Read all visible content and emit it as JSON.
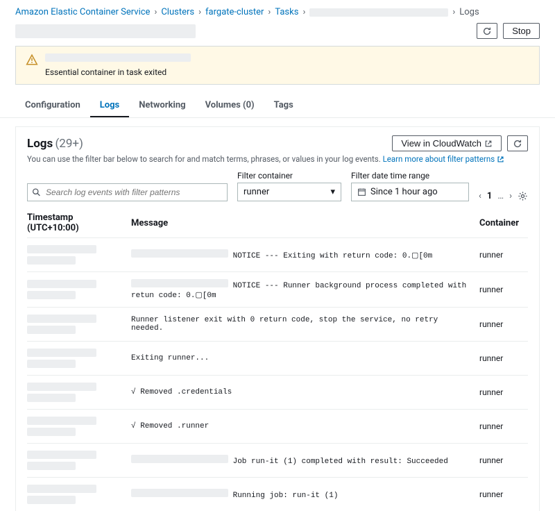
{
  "breadcrumb": {
    "items": [
      "Amazon Elastic Container Service",
      "Clusters",
      "fargate-cluster",
      "Tasks"
    ],
    "redacted": true,
    "current": "Logs"
  },
  "headerButtons": {
    "stop": "Stop"
  },
  "alert": {
    "sub": "Essential container in task exited"
  },
  "tabs": [
    {
      "label": "Configuration",
      "active": false
    },
    {
      "label": "Logs",
      "active": true
    },
    {
      "label": "Networking",
      "active": false
    },
    {
      "label": "Volumes (0)",
      "active": false
    },
    {
      "label": "Tags",
      "active": false
    }
  ],
  "logs": {
    "title": "Logs",
    "count": "(29+)",
    "viewBtn": "View in CloudWatch",
    "help": "You can use the filter bar below to search for and match terms, phrases, or values in your log events.",
    "helpLink": "Learn more about filter patterns",
    "searchPlaceholder": "Search log events with filter patterns",
    "filterContainerLabel": "Filter container",
    "filterContainerValue": "runner",
    "filterDateLabel": "Filter date time range",
    "filterDateValue": "Since 1 hour ago",
    "page": "1",
    "ellipsis": "…",
    "columns": {
      "ts": "Timestamp (UTC+10:00)",
      "msg": "Message",
      "ct": "Container"
    },
    "rows": [
      {
        "msgPrefixRedacted": true,
        "msg": "NOTICE --- Exiting with return code: 0.▢[0m",
        "container": "runner"
      },
      {
        "msgPrefixRedacted": true,
        "msg": "NOTICE --- Runner background process completed with retun code: 0.▢[0m",
        "container": "runner"
      },
      {
        "msg": "Runner listener exit with 0 return code, stop the service, no retry needed.",
        "container": "runner"
      },
      {
        "msg": "Exiting runner...",
        "container": "runner"
      },
      {
        "msg": "√ Removed .credentials",
        "container": "runner"
      },
      {
        "msg": "√ Removed .runner",
        "container": "runner"
      },
      {
        "msgPrefixRedacted": true,
        "msg": "Job run-it (1) completed with result: Succeeded",
        "container": "runner"
      },
      {
        "msgPrefixRedacted": true,
        "msg": "Running job: run-it (1)",
        "container": "runner"
      }
    ]
  }
}
